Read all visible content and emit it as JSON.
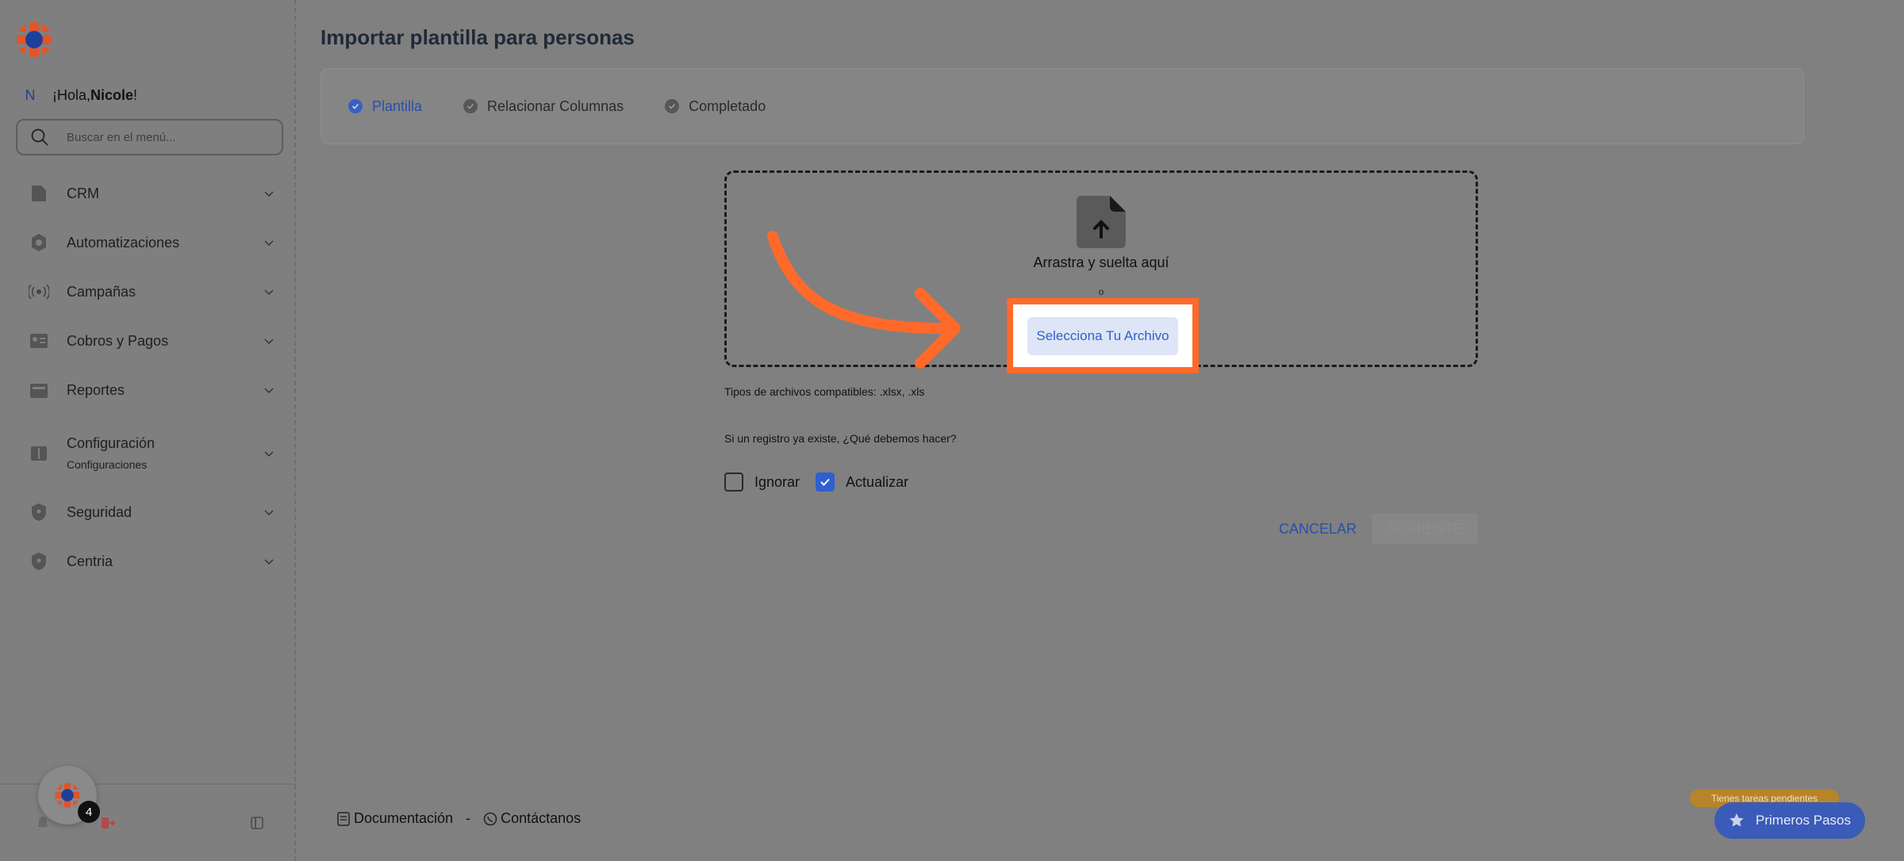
{
  "sidebar": {
    "greeting_prefix": "¡Hola, ",
    "user_name": "Nicole",
    "greeting_suffix": "!",
    "avatar_initial": "N",
    "search_placeholder": "Buscar en el menú...",
    "items": [
      {
        "label": "CRM",
        "icon": "file-icon"
      },
      {
        "label": "Automatizaciones",
        "icon": "gear-icon"
      },
      {
        "label": "Campañas",
        "icon": "broadcast-icon"
      },
      {
        "label": "Cobros y Pagos",
        "icon": "id-card-icon"
      },
      {
        "label": "Reportes",
        "icon": "report-icon"
      },
      {
        "label": "Configuración",
        "sublabel": "Configuraciones",
        "icon": "book-icon"
      },
      {
        "label": "Seguridad",
        "icon": "shield-icon"
      },
      {
        "label": "Centria",
        "icon": "shield-icon"
      }
    ],
    "notification_count": "4"
  },
  "main": {
    "title": "Importar plantilla para personas",
    "steps": [
      {
        "label": "Plantilla",
        "active": true
      },
      {
        "label": "Relacionar Columnas",
        "active": false
      },
      {
        "label": "Completado",
        "active": false
      }
    ],
    "dropzone": {
      "drop_text": "Arrastra y suelta aquí",
      "or_text": "o",
      "select_label": "Selecciona Tu Archivo"
    },
    "compat_text": "Tipos de archivos compatibles: .xlsx, .xls",
    "question": "Si un registro ya existe, ¿Qué debemos hacer?",
    "options": [
      {
        "label": "Ignorar",
        "checked": false
      },
      {
        "label": "Actualizar",
        "checked": true
      }
    ],
    "cancel_label": "CANCELAR",
    "next_label": "SIGUIENTE"
  },
  "footer": {
    "docs": "Documentación",
    "separator": "-",
    "contact": "Contáctanos"
  },
  "widget": {
    "pending": "Tienes tareas pendientes",
    "primeros": "Primeros Pasos"
  },
  "colors": {
    "accent": "#3360c8",
    "highlight": "#ff6a2b",
    "brand_orange": "#e0552a",
    "brand_blue": "#1d3f9a"
  }
}
